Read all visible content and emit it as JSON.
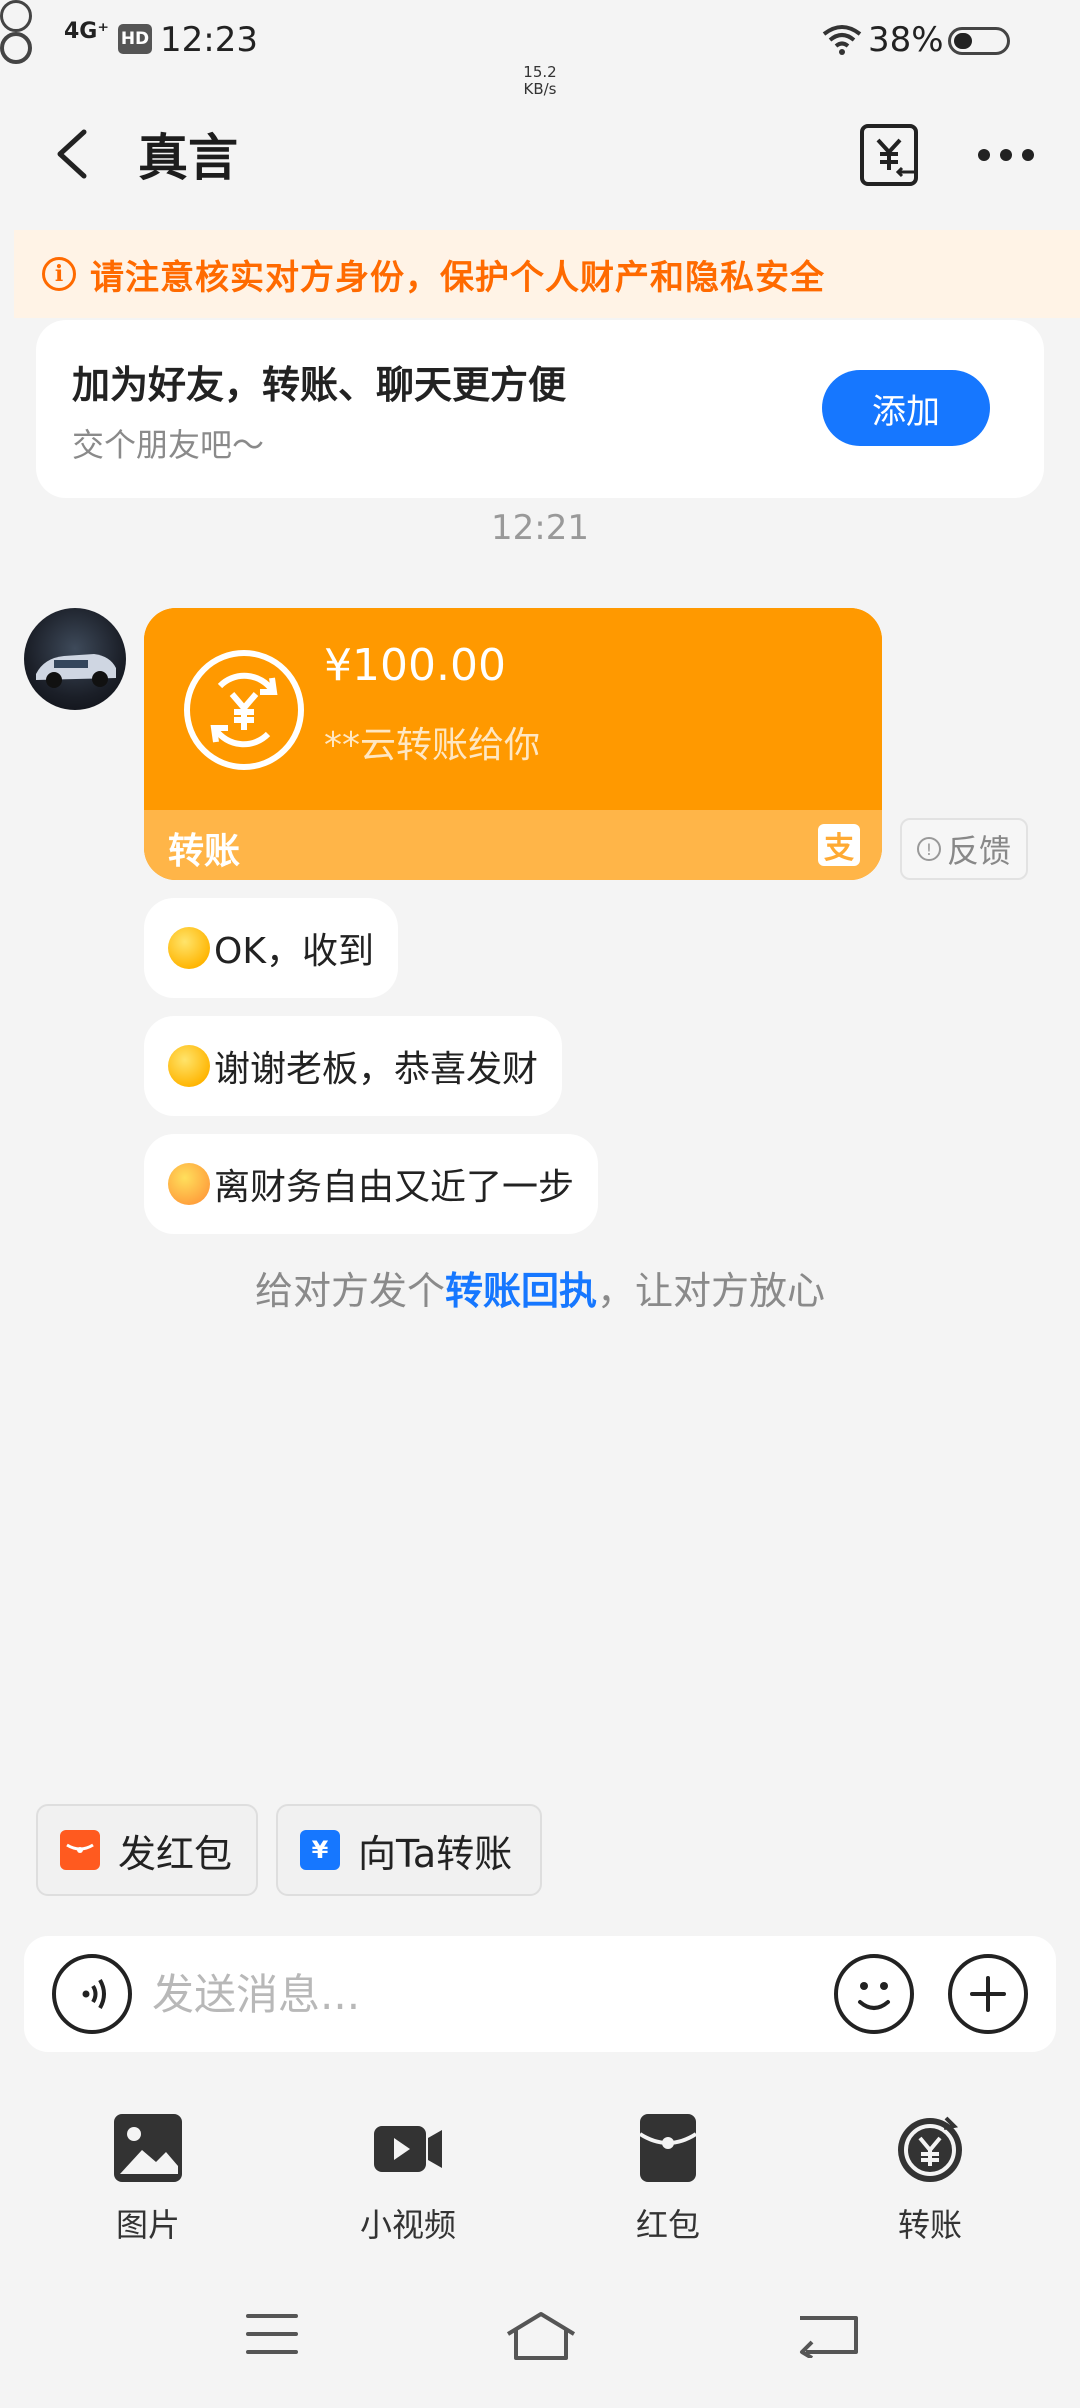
{
  "status_bar": {
    "network": "4G⁺",
    "hd": "HD",
    "time": "12:23",
    "speed_value": "15.2",
    "speed_unit": "KB/s",
    "battery": "38%"
  },
  "header": {
    "title": "真言"
  },
  "warning": {
    "text": "请注意核实对方身份，保护个人财产和隐私安全"
  },
  "friend_card": {
    "title": "加为好友，转账、聊天更方便",
    "subtitle": "交个朋友吧～",
    "add_label": "添加"
  },
  "chat": {
    "time": "12:21",
    "transfer": {
      "amount": "¥100.00",
      "from": "**云转账给你",
      "label": "转账"
    },
    "feedback_label": "反馈",
    "messages": [
      {
        "text": "OK，收到"
      },
      {
        "text": "谢谢老板，恭喜发财"
      },
      {
        "text": "离财务自由又近了一步"
      }
    ],
    "receipt_hint": {
      "prefix": "给对方发个",
      "link": "转账回执",
      "suffix": "，让对方放心"
    }
  },
  "quick_actions": {
    "red_packet": "发红包",
    "transfer": "向Ta转账"
  },
  "input": {
    "placeholder": "发送消息..."
  },
  "tools": [
    {
      "label": "图片",
      "icon": "image-icon"
    },
    {
      "label": "小视频",
      "icon": "video-icon"
    },
    {
      "label": "红包",
      "icon": "red-packet-icon"
    },
    {
      "label": "转账",
      "icon": "transfer-icon"
    }
  ],
  "colors": {
    "accent": "#1677ff",
    "transfer_orange": "#ff9900",
    "warning_orange": "#ff6a00"
  }
}
